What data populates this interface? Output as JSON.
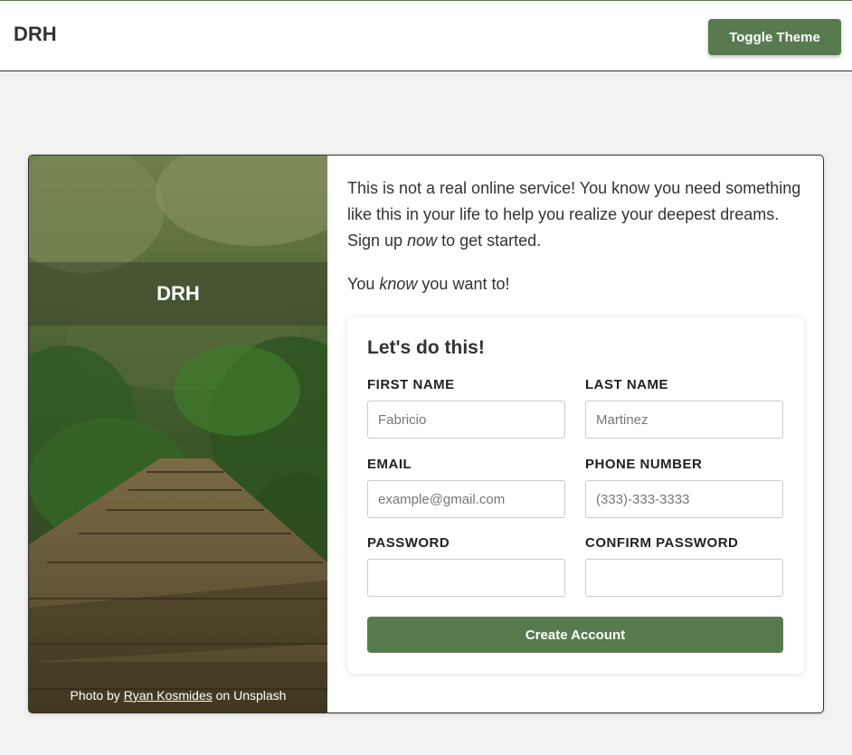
{
  "header": {
    "brand": "DRH",
    "toggle_theme_label": "Toggle Theme"
  },
  "photo": {
    "overlay_title": "DRH",
    "credit_prefix": "Photo by ",
    "credit_author": "Ryan Kosmides",
    "credit_suffix": " on Unsplash"
  },
  "intro": {
    "p1_start": "This is not a real online service! You know you need something like this in your life to help you realize your deepest dreams. Sign up ",
    "p1_em": "now",
    "p1_end": " to get started.",
    "p2_start": "You ",
    "p2_em": "know",
    "p2_end": " you want to!"
  },
  "form": {
    "title": "Let's do this!",
    "first_name": {
      "label": "FIRST NAME",
      "placeholder": "Fabricio",
      "value": ""
    },
    "last_name": {
      "label": "LAST NAME",
      "placeholder": "Martinez",
      "value": ""
    },
    "email": {
      "label": "EMAIL",
      "placeholder": "example@gmail.com",
      "value": ""
    },
    "phone": {
      "label": "PHONE NUMBER",
      "placeholder": "(333)-333-3333",
      "value": ""
    },
    "password": {
      "label": "PASSWORD",
      "placeholder": "",
      "value": ""
    },
    "confirm_password": {
      "label": "CONFIRM PASSWORD",
      "placeholder": "",
      "value": ""
    },
    "submit_label": "Create Account"
  },
  "colors": {
    "accent": "#587a4f",
    "background": "#f2f2f2"
  }
}
